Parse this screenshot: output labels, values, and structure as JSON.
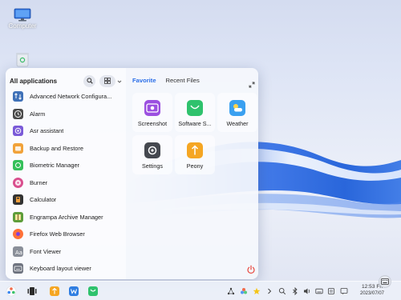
{
  "desktop": {
    "icons": [
      {
        "label": "Computer"
      },
      {
        "label": ""
      }
    ]
  },
  "start_menu": {
    "list_title": "All applications",
    "apps": [
      {
        "label": "Advanced Network Configura...",
        "icon": "network-icon",
        "color": "#3f71b8"
      },
      {
        "label": "Alarm",
        "icon": "alarm-icon",
        "color": "#4b4b4b"
      },
      {
        "label": "Asr assistant",
        "icon": "asr-icon",
        "color": "#7a5ad8"
      },
      {
        "label": "Backup and Restore",
        "icon": "backup-icon",
        "color": "#f1a23a"
      },
      {
        "label": "Biometric Manager",
        "icon": "biometric-icon",
        "color": "#35c05a"
      },
      {
        "label": "Burner",
        "icon": "burner-icon",
        "color": "#d94f8e"
      },
      {
        "label": "Calculator",
        "icon": "calculator-icon",
        "color": "#333333"
      },
      {
        "label": "Engrampa Archive Manager",
        "icon": "archive-icon",
        "color": "#5d9d3a"
      },
      {
        "label": "Firefox Web Browser",
        "icon": "firefox-icon",
        "color": "#ff7139"
      },
      {
        "label": "Font Viewer",
        "icon": "font-icon",
        "color": "#8a8f99"
      },
      {
        "label": "Keyboard layout viewer",
        "icon": "keyboard-icon",
        "color": "#6f7480"
      }
    ],
    "tabs": [
      {
        "label": "Favorite",
        "active": true
      },
      {
        "label": "Recent Files",
        "active": false
      }
    ],
    "favorites": [
      {
        "label": "Screenshot",
        "icon": "screenshot-icon",
        "color": "#9b4fe0"
      },
      {
        "label": "Software S...",
        "icon": "software-store-icon",
        "color": "#2fc26d"
      },
      {
        "label": "Weather",
        "icon": "weather-icon",
        "color": "#3aa0f0"
      },
      {
        "label": "Settings",
        "icon": "settings-icon",
        "color": "#45484f"
      },
      {
        "label": "Peony",
        "icon": "peony-icon",
        "color": "#f5a623"
      }
    ]
  },
  "taskbar": {
    "time": "12:53 Fri",
    "date": "2023/07/07",
    "pinned": [
      {
        "name": "start-button",
        "icon": "start-icon",
        "color": "#ffffff"
      },
      {
        "name": "multitask-view",
        "icon": "multitask-icon",
        "color": "#2b2b2b"
      },
      {
        "name": "peony-file-manager",
        "icon": "peony-icon",
        "color": "#f5a623"
      },
      {
        "name": "wps-office",
        "icon": "wps-icon",
        "color": "#2f7de1"
      },
      {
        "name": "software-store",
        "icon": "software-store-icon",
        "color": "#2fc26d"
      }
    ]
  },
  "colors": {
    "accent": "#2a6ee8",
    "power": "#e8453c"
  }
}
